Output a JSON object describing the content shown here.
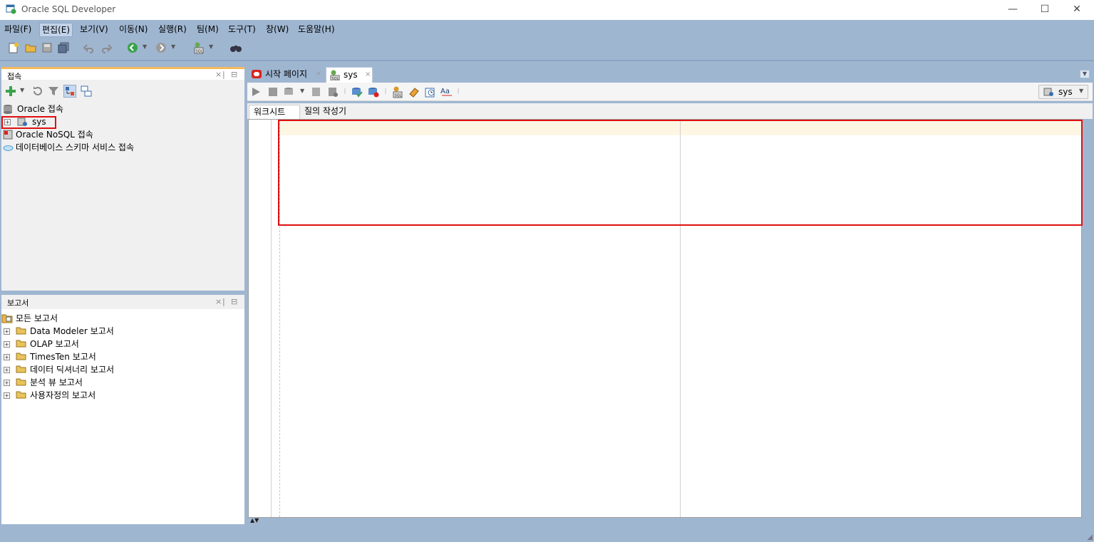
{
  "window": {
    "title": "Oracle SQL Developer",
    "minimize": "—",
    "maximize": "☐",
    "close": "✕"
  },
  "menu": [
    {
      "label": "파일(F)"
    },
    {
      "label": "편집(E)"
    },
    {
      "label": "보기(V)"
    },
    {
      "label": "이동(N)"
    },
    {
      "label": "실행(R)"
    },
    {
      "label": "팀(M)"
    },
    {
      "label": "도구(T)"
    },
    {
      "label": "창(W)"
    },
    {
      "label": "도움말(H)"
    }
  ],
  "connections_panel": {
    "title": "접속",
    "tree": [
      {
        "label": "Oracle 접속"
      },
      {
        "label": "sys"
      },
      {
        "label": "Oracle NoSQL 접속"
      },
      {
        "label": "데이터베이스 스키마 서비스 접속"
      }
    ]
  },
  "reports_panel": {
    "title": "보고서",
    "tree": [
      {
        "label": "모든 보고서"
      },
      {
        "label": "Data Modeler 보고서"
      },
      {
        "label": "OLAP 보고서"
      },
      {
        "label": "TimesTen 보고서"
      },
      {
        "label": "데이터 딕셔너리 보고서"
      },
      {
        "label": "분석 뷰 보고서"
      },
      {
        "label": "사용자정의 보고서"
      }
    ]
  },
  "editor": {
    "tabs": [
      {
        "label": "시작 페이지"
      },
      {
        "label": "sys"
      }
    ],
    "connection_selector": "sys",
    "subtabs": [
      {
        "label": "워크시트"
      },
      {
        "label": "질의 작성기"
      }
    ]
  },
  "colors": {
    "chrome": "#9fb6d1",
    "panel_accent": "#f5b95c",
    "highlight": "#e01010",
    "oracle_red": "#d9231f"
  }
}
